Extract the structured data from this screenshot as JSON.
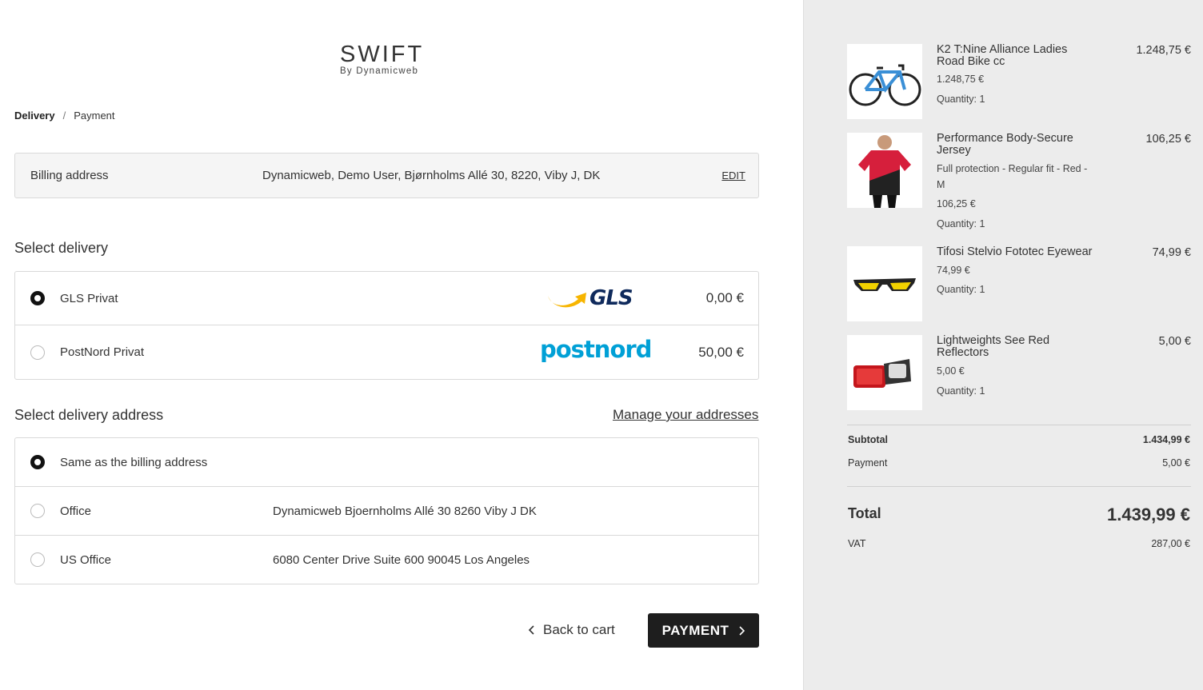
{
  "logo": {
    "main": "SWIFT",
    "sub": "By Dynamicweb"
  },
  "breadcrumb": {
    "step1": "Delivery",
    "separator": "/",
    "step2": "Payment"
  },
  "billing": {
    "label": "Billing address",
    "value": "Dynamicweb, Demo User, Bjørnholms Allé 30, 8220, Viby J, DK",
    "edit": "EDIT"
  },
  "delivery": {
    "title": "Select delivery",
    "options": [
      {
        "name": "GLS Privat",
        "logo": "GLS",
        "price": "0,00 €",
        "selected": true
      },
      {
        "name": "PostNord Privat",
        "logo": "postnord",
        "price": "50,00 €",
        "selected": false
      }
    ]
  },
  "address": {
    "title": "Select delivery address",
    "manage_link": "Manage your addresses",
    "options": [
      {
        "name": "Same as the billing address",
        "detail": "",
        "selected": true
      },
      {
        "name": "Office",
        "detail": "Dynamicweb Bjoernholms Allé 30 8260 Viby J DK",
        "selected": false
      },
      {
        "name": "US Office",
        "detail": "6080 Center Drive Suite 600 90045 Los Angeles",
        "selected": false
      }
    ]
  },
  "actions": {
    "back": "Back to cart",
    "payment": "PAYMENT"
  },
  "cart": {
    "items": [
      {
        "name": "K2 T:Nine Alliance Ladies Road Bike cc",
        "price": "1.248,75 €",
        "variant": "",
        "unit_price": "1.248,75 €",
        "quantity": "Quantity: 1",
        "image": "bike-image"
      },
      {
        "name": "Performance Body-Secure Jersey",
        "price": "106,25 €",
        "variant": "Full protection - Regular fit - Red - M",
        "unit_price": "106,25 €",
        "quantity": "Quantity: 1",
        "image": "jersey-image"
      },
      {
        "name": "Tifosi Stelvio Fototec Eyewear",
        "price": "74,99 €",
        "variant": "",
        "unit_price": "74,99 €",
        "quantity": "Quantity: 1",
        "image": "eyewear-image"
      },
      {
        "name": "Lightweights See Red Reflectors",
        "price": "5,00 €",
        "variant": "",
        "unit_price": "5,00 €",
        "quantity": "Quantity: 1",
        "image": "reflector-image"
      }
    ],
    "subtotal_label": "Subtotal",
    "subtotal": "1.434,99 €",
    "payment_label": "Payment",
    "payment": "5,00 €",
    "total_label": "Total",
    "total": "1.439,99 €",
    "vat_label": "VAT",
    "vat": "287,00 €"
  },
  "colors": {
    "accent": "#e8542e",
    "button": "#1e1e1e",
    "sidebar_bg": "#ececec",
    "gls_yellow": "#f7b500",
    "gls_blue": "#0f2a5c",
    "postnord_blue": "#00a0d6"
  }
}
